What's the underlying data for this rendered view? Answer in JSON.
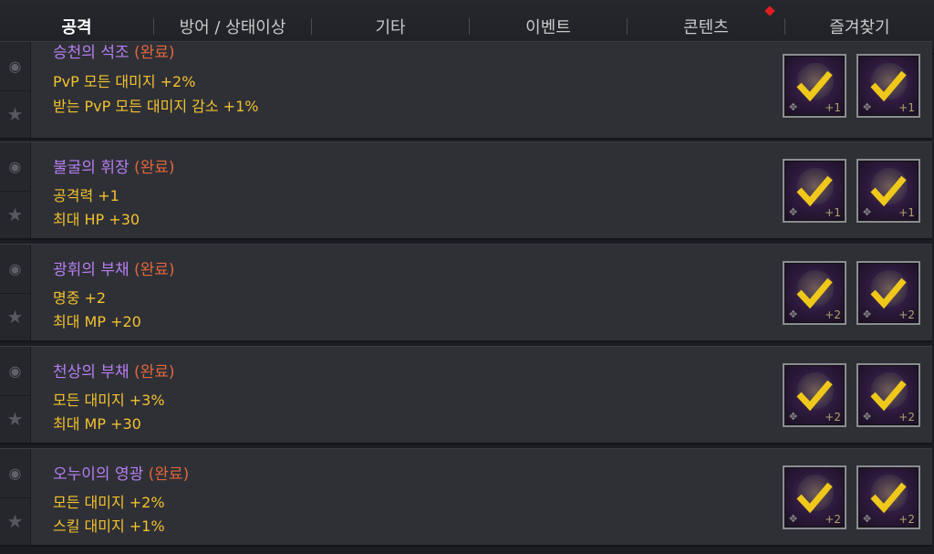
{
  "tabs": [
    {
      "label": "공격",
      "active": true
    },
    {
      "label": "방어 / 상태이상",
      "active": false
    },
    {
      "label": "기타",
      "active": false
    },
    {
      "label": "이벤트",
      "active": false
    },
    {
      "label": "콘텐츠",
      "active": false,
      "notify": true
    },
    {
      "label": "즐겨찾기",
      "active": false
    }
  ],
  "colors": {
    "title": "#b77ef0",
    "done": "#e1663c",
    "stat": "#f2c12e",
    "check": "#f0c81a",
    "notify": "#e01e1e"
  },
  "entries": [
    {
      "title": "승천의 석조",
      "status": "(완료)",
      "stats": [
        "PvP 모든 대미지 +2%",
        "받는 PvP 모든 대미지 감소 +1%"
      ],
      "slots": [
        "+1",
        "+1"
      ]
    },
    {
      "title": "불굴의 휘장",
      "status": "(완료)",
      "stats": [
        "공격력 +1",
        "최대 HP +30"
      ],
      "slots": [
        "+1",
        "+1"
      ]
    },
    {
      "title": "광휘의 부채",
      "status": "(완료)",
      "stats": [
        "명중 +2",
        "최대 MP +20"
      ],
      "slots": [
        "+2",
        "+2"
      ]
    },
    {
      "title": "천상의 부채",
      "status": "(완료)",
      "stats": [
        "모든 대미지 +3%",
        "최대 MP +30"
      ],
      "slots": [
        "+2",
        "+2"
      ]
    },
    {
      "title": "오누이의 영광",
      "status": "(완료)",
      "stats": [
        "모든 대미지 +2%",
        "스킬 대미지 +1%"
      ],
      "slots": [
        "+2",
        "+2"
      ]
    }
  ],
  "icons": {
    "eye": "eye-icon",
    "star": "star-icon",
    "check": "check-icon",
    "dpad": "dpad-icon"
  }
}
